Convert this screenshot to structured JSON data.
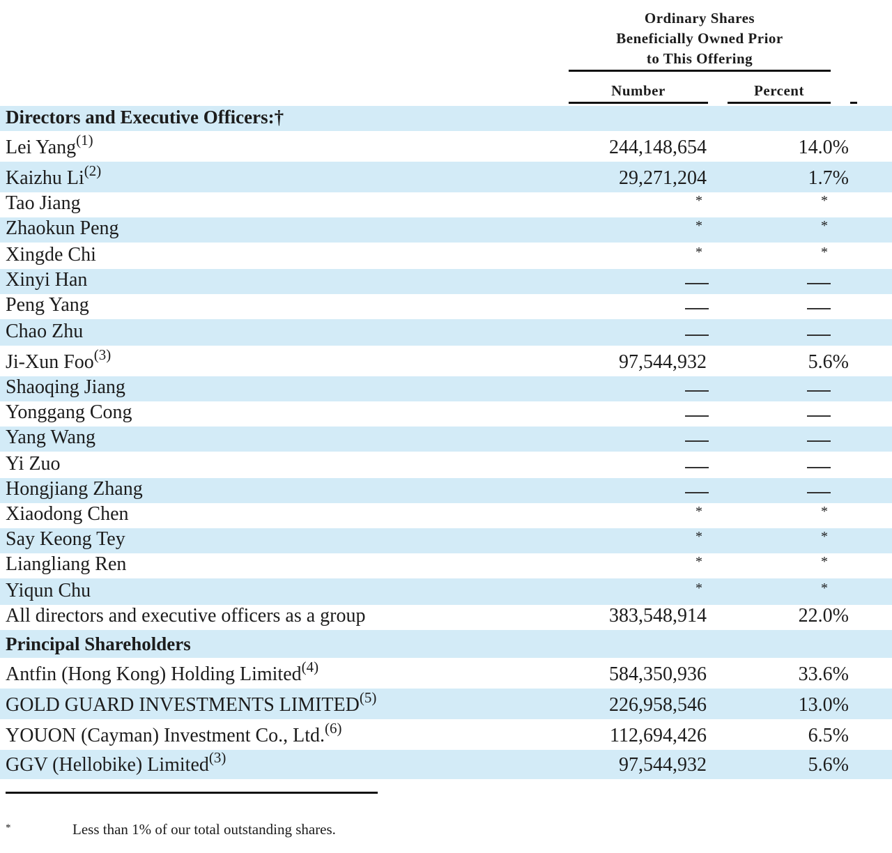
{
  "header": {
    "group_line1": "Ordinary Shares",
    "group_line2": "Beneficially Owned Prior",
    "group_line3": "to This Offering",
    "col_number": "Number",
    "col_percent": "Percent"
  },
  "rows": [
    {
      "kind": "section",
      "name": "Directors and Executive Officers:†"
    },
    {
      "name": "Lei Yang",
      "note": "(1)",
      "number": "244,148,654",
      "percent": "14.0%"
    },
    {
      "name": "Kaizhu Li",
      "note": "(2)",
      "number": "29,271,204",
      "percent": "1.7%"
    },
    {
      "name": "Tao Jiang",
      "number": "*",
      "percent": "*"
    },
    {
      "name": "Zhaokun Peng",
      "number": "*",
      "percent": "*"
    },
    {
      "name": "Xingde Chi",
      "number": "*",
      "percent": "*"
    },
    {
      "name": "Xinyi Han",
      "number": "—",
      "percent": "—"
    },
    {
      "name": "Peng Yang",
      "number": "—",
      "percent": "—"
    },
    {
      "name": "Chao Zhu",
      "number": "—",
      "percent": "—"
    },
    {
      "name": "Ji-Xun Foo",
      "note": "(3)",
      "number": "97,544,932",
      "percent": "5.6%"
    },
    {
      "name": "Shaoqing Jiang",
      "number": "—",
      "percent": "—"
    },
    {
      "name": "Yonggang Cong",
      "number": "—",
      "percent": "—"
    },
    {
      "name": "Yang Wang",
      "number": "—",
      "percent": "—"
    },
    {
      "name": "Yi Zuo",
      "number": "—",
      "percent": "—"
    },
    {
      "name": "Hongjiang Zhang",
      "number": "—",
      "percent": "—"
    },
    {
      "name": "Xiaodong Chen",
      "number": "*",
      "percent": "*"
    },
    {
      "name": "Say Keong Tey",
      "number": "*",
      "percent": "*"
    },
    {
      "name": "Liangliang Ren",
      "number": "*",
      "percent": "*"
    },
    {
      "name": "Yiqun Chu",
      "number": "*",
      "percent": "*"
    },
    {
      "name": "All directors and executive officers as a group",
      "number": "383,548,914",
      "percent": "22.0%"
    },
    {
      "kind": "section",
      "name": "Principal Shareholders"
    },
    {
      "name": "Antfin (Hong Kong) Holding Limited",
      "note": "(4)",
      "number": "584,350,936",
      "percent": "33.6%"
    },
    {
      "name": "GOLD GUARD INVESTMENTS LIMITED",
      "note": "(5)",
      "number": "226,958,546",
      "percent": "13.0%"
    },
    {
      "name": "YOUON (Cayman) Investment Co., Ltd.",
      "note": "(6)",
      "number": "112,694,426",
      "percent": "6.5%"
    },
    {
      "name": "GGV (Hellobike) Limited",
      "note": "(3)",
      "number": "97,544,932",
      "percent": "5.6%"
    }
  ],
  "footnote": {
    "symbol": "*",
    "text": "Less than 1% of our total outstanding shares."
  },
  "colors": {
    "row_shade": "#d3ebf7",
    "text": "#1c1c1c"
  }
}
